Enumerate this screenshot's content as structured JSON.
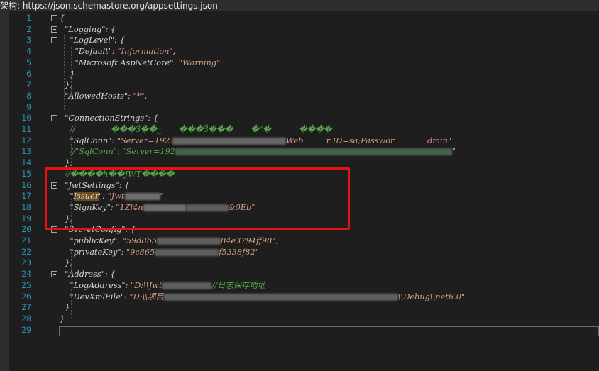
{
  "schema_bar": {
    "label": "架构:",
    "url": "https://json.schemastore.org/appsettings.json"
  },
  "line_numbers": [
    "1",
    "2",
    "3",
    "4",
    "5",
    "6",
    "7",
    "8",
    "9",
    "10",
    "11",
    "12",
    "13",
    "14",
    "15",
    "16",
    "17",
    "18",
    "19",
    "20",
    "21",
    "22",
    "23",
    "24",
    "25",
    "26",
    "27",
    "28",
    "29"
  ],
  "code_lines": [
    "{",
    "  \"Logging\": {",
    "    \"LogLevel\": {",
    "      \"Default\": \"Information\",",
    "      \"Microsoft.AspNetCore\": \"Warning\"",
    "    }",
    "  },",
    "  \"AllowedHosts\": \"*\",",
    "",
    "  \"ConnectionStrings\": {",
    "    //              ���Ӟ��_       ���Ӟ���       �\"�           ����",
    "    \"SqlConn\": \"Server=192.",
    "    //\"SqlConn\": \"Server=192",
    "  },",
    "  //����h��JWT����",
    "  \"JwtSettings\": {",
    "    \"Issuer\": \"Jwt",
    "    \"SignKey\": \"1Zl4n",
    "  },",
    "  \"SecretConfig\": {",
    "    \"publicKey\": \"59d8b5",
    "    \"privateKey\": \"9c865",
    "  },",
    "  \"Address\": {",
    "    \"LogAddress\": \"D:\\\\Jwt",
    "    \"DevXmlFile\": \"D:\\\\项目",
    "  }",
    "}",
    ""
  ],
  "fragments": {
    "sqlconn_tail": "Web         r ID=sa;Passwor             dmin\"",
    "sqlconn2_tail": "\"",
    "signkey_tail": "&0Eb\"",
    "issuer_tail": "\",",
    "publickey_tail": "84e3794ff98\",",
    "privatekey_tail": "f5338f82\"",
    "logaddress_tail": "//日志保存地址",
    "devxml_tail": "\\\\Debug\\\\net6.0\""
  },
  "colors": {
    "keyword": "#d4d4d4",
    "string": "#d69d85",
    "comment": "#57a64a",
    "line_number": "#2b91af",
    "highlight_box": "#e81111"
  }
}
